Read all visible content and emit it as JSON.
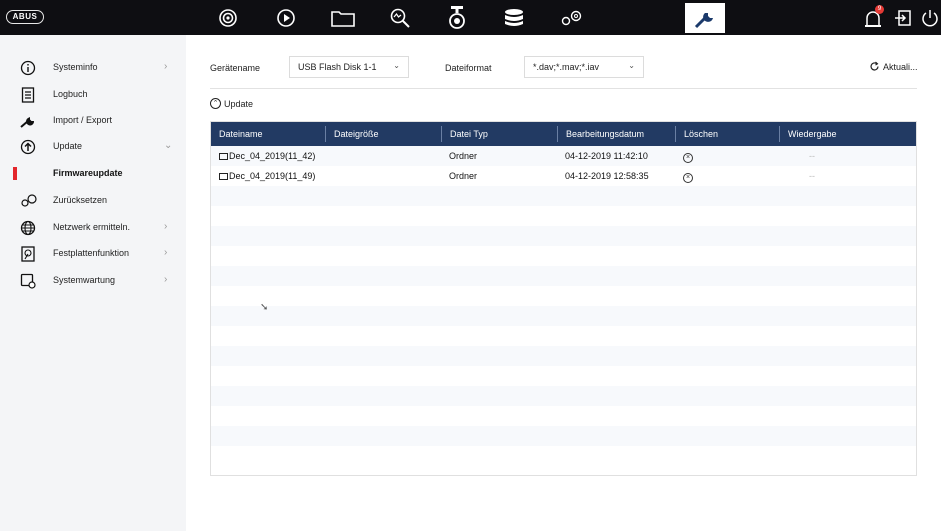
{
  "logo": "ABUS",
  "topbar": {
    "icons": [
      "live-view-camera-icon",
      "playback-icon",
      "folder-icon",
      "search-icon",
      "camera-icon",
      "storage-icon",
      "settings-icon",
      "maintenance-wrench-icon"
    ],
    "notification_count": "9",
    "right_icons": [
      "alarm-icon",
      "logout-icon",
      "power-icon"
    ]
  },
  "sidebar": {
    "items": [
      {
        "label": "Systeminfo",
        "icon": "info-icon",
        "chevron": "›"
      },
      {
        "label": "Logbuch",
        "icon": "log-icon",
        "chevron": ""
      },
      {
        "label": "Import / Export",
        "icon": "wrench-icon",
        "chevron": ""
      },
      {
        "label": "Update",
        "icon": "upload-icon",
        "chevron": "⌄"
      },
      {
        "label": "Firmwareupdate",
        "icon": "",
        "chevron": ""
      },
      {
        "label": "Zurücksetzen",
        "icon": "reset-icon",
        "chevron": ""
      },
      {
        "label": "Netzwerk ermitteln.",
        "icon": "globe-icon",
        "chevron": "›"
      },
      {
        "label": "Festplattenfunktion",
        "icon": "disk-icon",
        "chevron": "›"
      },
      {
        "label": "Systemwartung",
        "icon": "system-maintenance-icon",
        "chevron": "›"
      }
    ],
    "active_color": "#e3262c"
  },
  "filters": {
    "device_label": "Gerätename",
    "device_value": "USB Flash Disk 1-1",
    "format_label": "Dateiformat",
    "format_value": "*.dav;*.mav;*.iav",
    "refresh_label": "Aktuali..."
  },
  "section": {
    "title": "Update"
  },
  "table": {
    "header_color": "#223a63",
    "columns": [
      "Dateiname",
      "Dateigröße",
      "Datei Typ",
      "Bearbeitungsdatum",
      "Löschen",
      "Wiedergabe"
    ],
    "rows": [
      {
        "name": "Dec_04_2019(11_42)",
        "size": "",
        "type": "Ordner",
        "date": "04-12-2019 11:42:10",
        "delete": "×",
        "play": "--"
      },
      {
        "name": "Dec_04_2019(11_49)",
        "size": "",
        "type": "Ordner",
        "date": "04-12-2019 12:58:35",
        "delete": "×",
        "play": "--"
      }
    ]
  }
}
